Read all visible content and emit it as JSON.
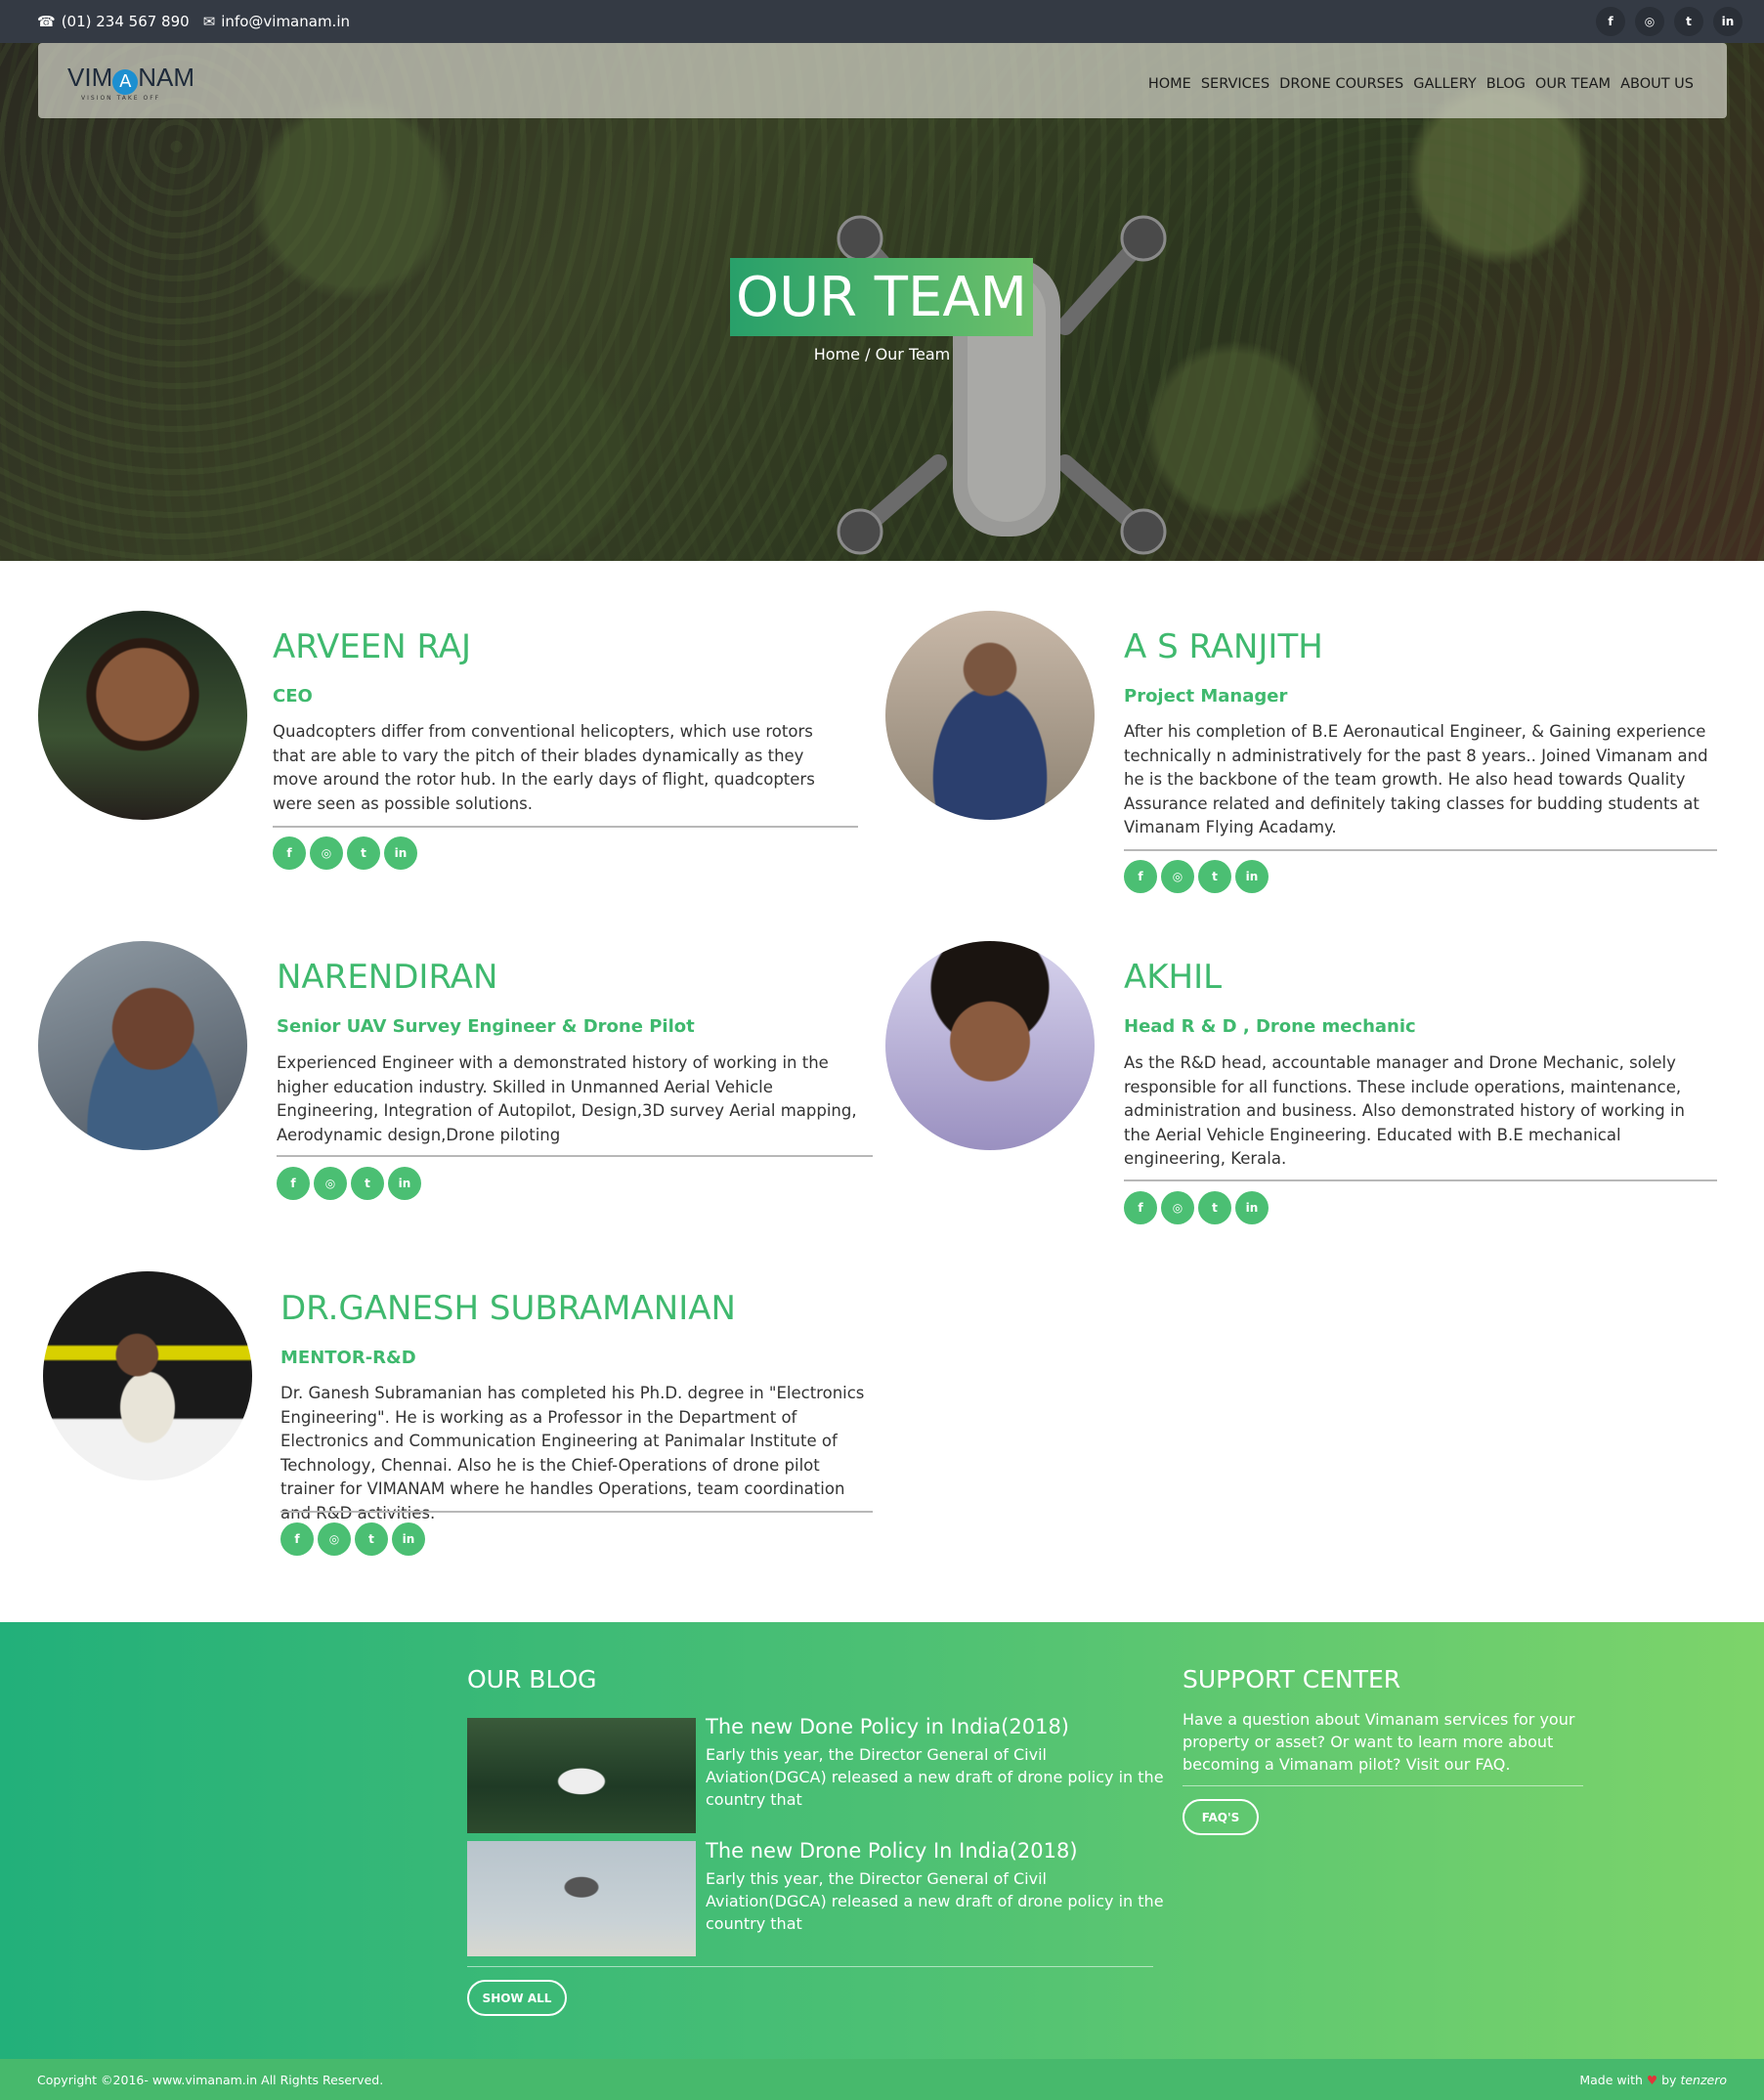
{
  "topbar": {
    "phone": "(01) 234 567 890",
    "email": "info@vimanam.in",
    "socials": [
      "f",
      "◎",
      "t",
      "in"
    ]
  },
  "brand": {
    "name_left": "VIM",
    "name_mid": "A",
    "name_right": "NAM",
    "tagline": "VISION TAKE OFF"
  },
  "nav": [
    "HOME",
    "SERVICES",
    "DRONE COURSES",
    "GALLERY",
    "BLOG",
    "OUR TEAM",
    "ABOUT US"
  ],
  "hero": {
    "title": "OUR TEAM",
    "breadcrumb": "Home / Our Team"
  },
  "team": [
    {
      "name": "ARVEEN RAJ",
      "role": "CEO",
      "bio": "Quadcopters differ from conventional helicopters, which use rotors that are able to vary the pitch of their blades dynamically as they move around the rotor hub. In the early days of flight, quadcopters were seen as possible solutions."
    },
    {
      "name": "A S RANJITH",
      "role": "Project Manager",
      "bio": "After his completion of B.E Aeronautical Engineer, & Gaining experience technically n administratively for the past 8 years.. Joined Vimanam and he is the backbone of the team growth. He also head towards Quality Assurance related and definitely taking classes for budding students at Vimanam Flying Acadamy."
    },
    {
      "name": "NARENDIRAN",
      "role": "Senior UAV Survey Engineer & Drone Pilot",
      "bio": "Experienced Engineer with a demonstrated history of working in the higher education industry. Skilled in Unmanned Aerial Vehicle Engineering, Integration of Autopilot, Design,3D survey Aerial mapping, Aerodynamic design,Drone piloting"
    },
    {
      "name": "AKHIL",
      "role": "Head R & D , Drone mechanic",
      "bio": "As the R&D head, accountable manager and Drone Mechanic, solely responsible for all functions. These include operations, maintenance, administration and business. Also demonstrated history of working in the Aerial Vehicle Engineering. Educated with B.E mechanical engineering, Kerala."
    },
    {
      "name": "DR.GANESH SUBRAMANIAN",
      "role": "MENTOR-R&D",
      "bio": "Dr. Ganesh Subramanian has completed his Ph.D. degree in \"Electronics Engineering\". He is working as a Professor in the Department of Electronics and Communication Engineering at Panimalar Institute of Technology, Chennai. Also he is the Chief-Operations of drone pilot trainer for VIMANAM where he handles Operations, team coordination and R&D activities."
    }
  ],
  "member_socials": [
    "f",
    "◎",
    "t",
    "in"
  ],
  "footer": {
    "blog_heading": "OUR BLOG",
    "posts": [
      {
        "title": "The new Done Policy in India(2018)",
        "excerpt": "Early this year, the Director General of Civil Aviation(DGCA) released a new draft of drone policy in the country that"
      },
      {
        "title": "The new Drone Policy In India(2018)",
        "excerpt": "Early this year, the Director General of Civil Aviation(DGCA) released a new draft of drone policy in the country that"
      }
    ],
    "show_all": "SHOW ALL",
    "support_heading": "SUPPORT CENTER",
    "support_text": "Have a question about Vimanam services for your property or asset? Or want to learn more about becoming a Vimanam pilot? Visit our FAQ.",
    "faq": "FAQ'S"
  },
  "bottom": {
    "copyright": "Copyright ©2016- www.vimanam.in All Rights Reserved.",
    "made_with": "Made with",
    "by": "by",
    "author": "tenzero"
  },
  "colors": {
    "accent": "#3fb96e",
    "topbar": "#343a44"
  }
}
